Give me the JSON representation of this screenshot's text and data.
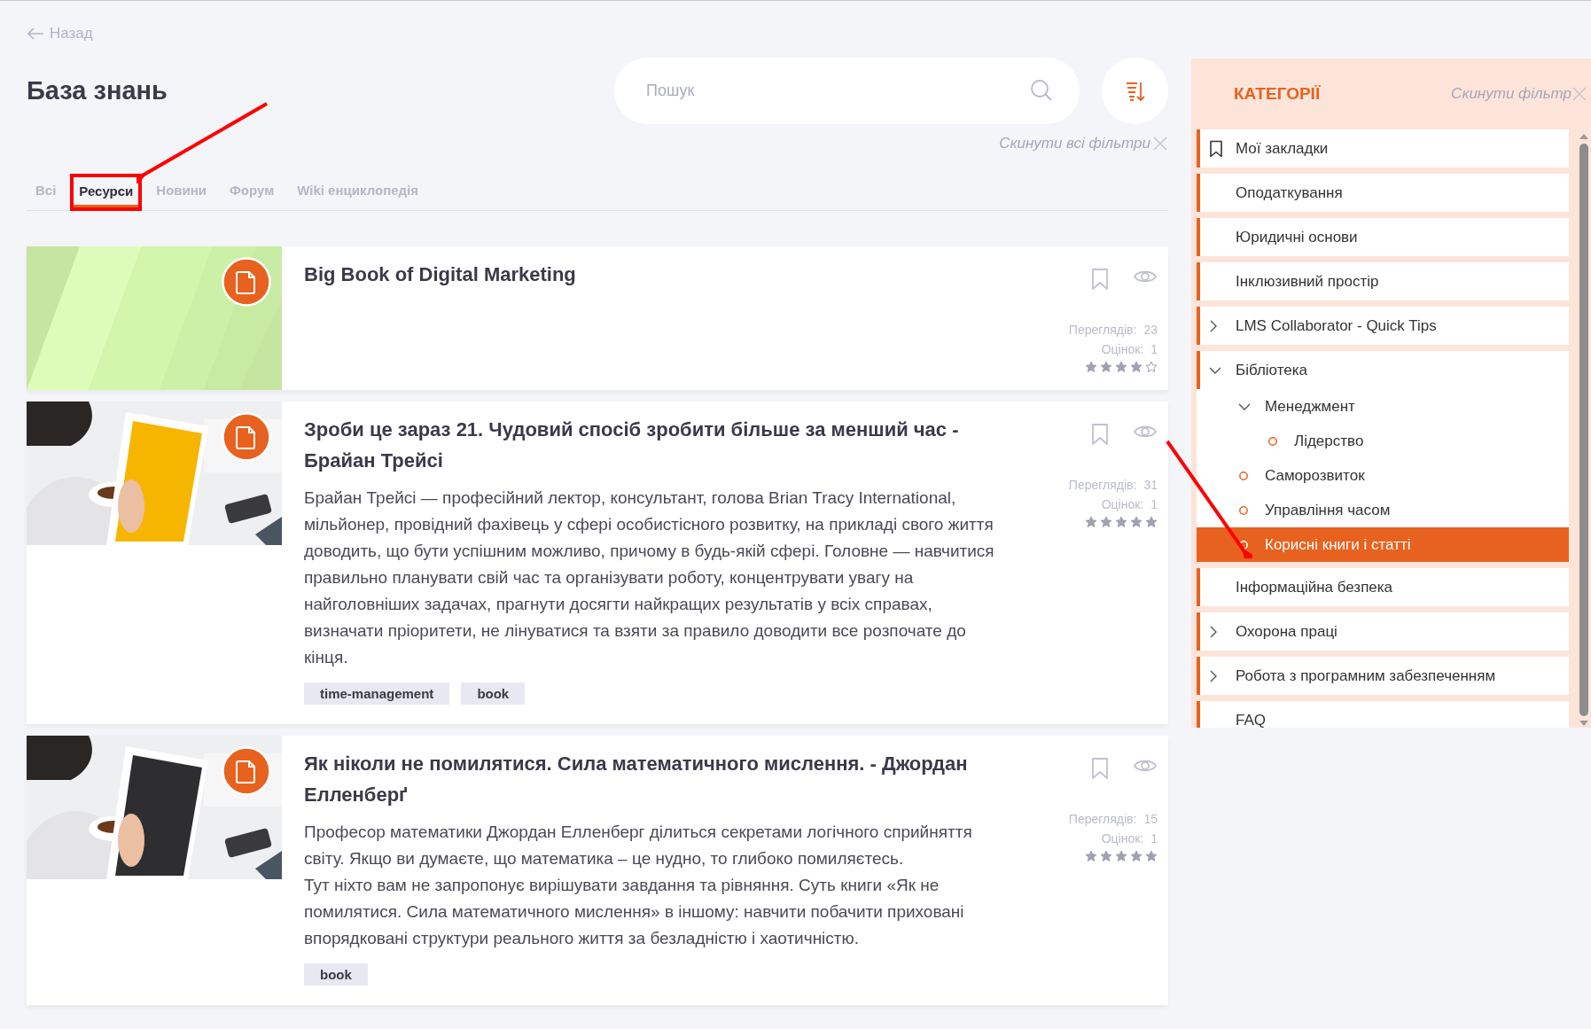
{
  "back_link": "Назад",
  "title": "База знань",
  "search": {
    "placeholder": "Пошук"
  },
  "reset_all_filters": "Скинути всі фільтри",
  "tabs": [
    {
      "label": "Всі",
      "selected": false,
      "annotated": false
    },
    {
      "label": "Ресурси",
      "selected": true,
      "annotated": true
    },
    {
      "label": "Новини",
      "selected": false,
      "annotated": false
    },
    {
      "label": "Форум",
      "selected": false,
      "annotated": false
    },
    {
      "label": "Wiki енциклопедія",
      "selected": false,
      "annotated": false
    }
  ],
  "cards": [
    {
      "image": {
        "kind": "picture"
      },
      "title": "Big Book of Digital Marketing",
      "views_label": "Переглядів:",
      "views": "23",
      "ratings_label": "Оцінок:",
      "ratings": "1",
      "stars": 4
    },
    {
      "image": {
        "kind": "picture"
      },
      "title": "Зроби це зараз 21. Чудовий спосіб зробити більше за менший час - Брайан Трейсі",
      "description": [
        "Брайан Трейсі — професійний лектор, консультант, голова Brian Tracy International, мільйонер, провідний фахівець у сфері особистісного розвитку, на прикладі свого життя доводить, що бути успішним можливо, причому в будь-якій сфері. Головне — навчитися правильно планувати свій час та організувати роботу, концентрувати увагу на найголовніших задачах, прагнути досягти найкращих результатів у всіх справах, визначати пріоритети, не лінуватися та взяти за правило доводити все розпочате до кінця."
      ],
      "tags": [
        "time-management",
        "book"
      ],
      "views_label": "Переглядів:",
      "views": "31",
      "ratings_label": "Оцінок:",
      "ratings": "1",
      "stars": 5
    },
    {
      "image": {
        "kind": "picture"
      },
      "title": "Як ніколи не помилятися. Сила математичного мислення. - Джордан Елленберґ",
      "description": [
        "Професор математики Джордан Елленберг ділиться секретами логічного сприйняття світу. Якщо ви думаєте, що математика – це нудно, то глибоко помиляєтесь.",
        "Тут ніхто вам не запропонує вирішувати завдання та рівняння. Суть книги «Як не помилятися. Сила математичного мислення» в іншому: навчити побачити приховані впорядковані структури реального життя за безладністю і хаотичністю."
      ],
      "tags": [
        "book"
      ],
      "views_label": "Переглядів:",
      "views": "15",
      "ratings_label": "Оцінок:",
      "ratings": "1",
      "stars": 5
    }
  ],
  "categories": {
    "title": "КАТЕГОРІЇ",
    "reset_filter": "Скинути фільтр",
    "items": [
      {
        "label": "Мої закладки",
        "kind": "bookmark",
        "selected": false,
        "annotated": false
      },
      {
        "label": "Оподаткування",
        "kind": "plain",
        "selected": false,
        "annotated": false
      },
      {
        "label": "Юридичні основи",
        "kind": "plain",
        "selected": false,
        "annotated": false
      },
      {
        "label": "Інклюзивний простір",
        "kind": "plain",
        "selected": false,
        "annotated": false
      },
      {
        "label": "LMS Collaborator - Quick Tips",
        "kind": "group",
        "expanded": false,
        "selected": false,
        "annotated": false
      },
      {
        "label": "Бібліотека",
        "kind": "group",
        "expanded": true,
        "selected": false,
        "annotated": false,
        "children": [
          {
            "label": "Менеджмент",
            "kind": "group",
            "expanded": true,
            "selected": false,
            "annotated": false,
            "children": [
              {
                "label": "Лідерство",
                "kind": "leaf",
                "selected": false,
                "annotated": false
              }
            ]
          },
          {
            "label": "Саморозвиток",
            "kind": "leaf",
            "selected": false,
            "annotated": false
          },
          {
            "label": "Управління часом",
            "kind": "leaf",
            "selected": false,
            "annotated": false
          },
          {
            "label": "Корисні книги і статті",
            "kind": "leaf",
            "selected": true,
            "annotated": true
          }
        ]
      },
      {
        "label": "Інформаційна безпека",
        "kind": "plain",
        "selected": false,
        "annotated": false
      },
      {
        "label": "Охорона праці",
        "kind": "group",
        "expanded": false,
        "selected": false,
        "annotated": false
      },
      {
        "label": "Робота з програмним забезпеченням",
        "kind": "group",
        "expanded": false,
        "selected": false,
        "annotated": false
      },
      {
        "label": "FAQ",
        "kind": "plain",
        "selected": false,
        "annotated": false
      }
    ]
  }
}
